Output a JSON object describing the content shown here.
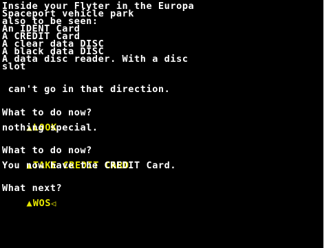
{
  "game": {
    "location_lines": [
      "Inside your Flyter in the Europa",
      "Spaceport vehicle park",
      "also to be seen:",
      "An IDENT Card",
      "A CREDIT Card",
      "A clear data DISC",
      "A black data DISC",
      "A data disc reader. With a disc",
      "slot"
    ],
    "message_no_direction": " can't go in that direction.",
    "prompt_1": "What to do now?",
    "command_1": "LOOK",
    "response_1": "nothing special.",
    "prompt_2": "What to do now?",
    "command_2": "TAKE CREDIT CARD",
    "response_2": "You now have the CREDIT Card.",
    "prompt_3": "What next?",
    "command_3_input": "WOS",
    "prompt_icon": "player-prompt-icon",
    "cursor_icon": "cursor-icon"
  },
  "colors": {
    "background": "#000000",
    "text": "#ffffff",
    "input": "#e8e800"
  }
}
